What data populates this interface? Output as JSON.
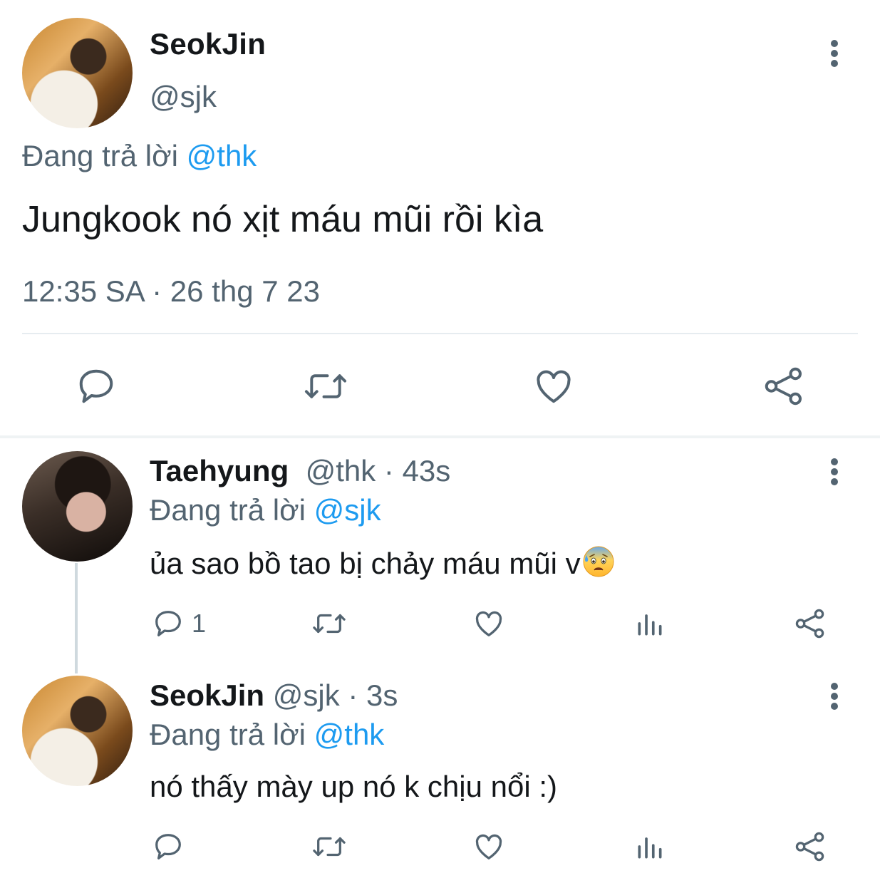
{
  "main_tweet": {
    "name": "SeokJin",
    "handle": "@sjk",
    "replying_prefix": "Đang trả lời",
    "replying_to": "@thk",
    "text": "Jungkook nó xịt máu mũi rồi kìa",
    "timestamp": "12:35 SA · 26 thg 7 23",
    "actions": [
      "reply-icon",
      "retweet-icon",
      "like-icon",
      "share-icon"
    ]
  },
  "replies": [
    {
      "name": "Taehyung",
      "handle": "@thk",
      "time": "· 43s",
      "replying_prefix": "Đang trả lời",
      "replying_to": "@sjk",
      "text": "ủa sao bồ tao bị chảy máu mũi v",
      "emoji": "anxious-face-with-sweat-icon",
      "reply_count": "1"
    },
    {
      "name": "SeokJin",
      "handle": "@sjk",
      "time": "· 3s",
      "replying_prefix": "Đang trả lời",
      "replying_to": "@thk",
      "text": "nó thấy mày up nó k chịu nổi :)",
      "reply_count": ""
    }
  ],
  "colors": {
    "text": "#14171a",
    "muted": "#536471",
    "link": "#1d9bf0",
    "divider": "#e6ecf0"
  }
}
